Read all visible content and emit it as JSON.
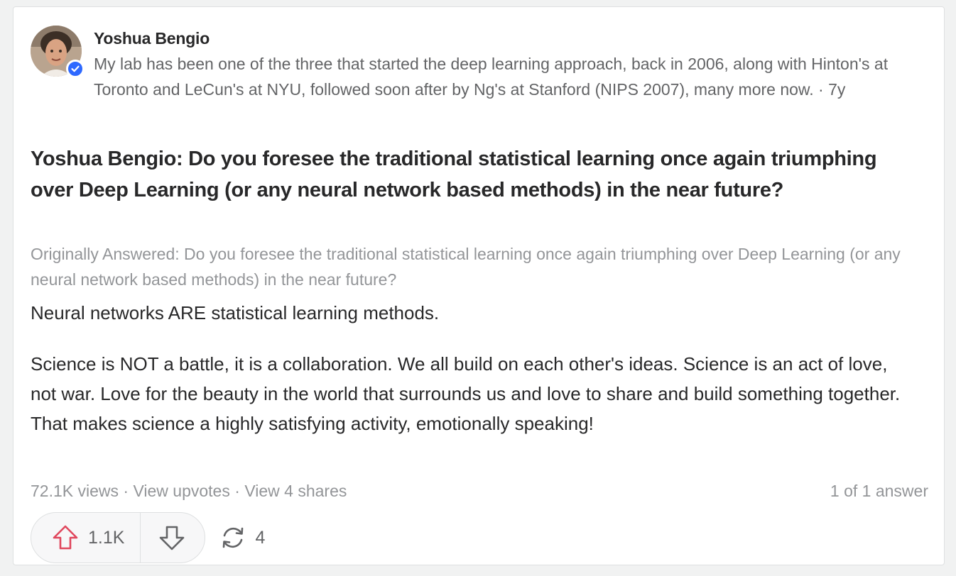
{
  "author": {
    "name": "Yoshua Bengio",
    "credential": "My lab has been one of the three that started the deep learning approach, back in 2006, along with Hinton's at Toronto and LeCun's at NYU, followed soon after by Ng's at Stanford (NIPS 2007), many more now.",
    "separator": "·",
    "time": "7y"
  },
  "question": {
    "title": "Yoshua Bengio: Do you foresee the traditional statistical learning once again triumphing over Deep Learning (or any neural network based methods) in the near future?",
    "originally_answered": "Originally Answered: Do you foresee the traditional statistical learning once again triumphing over Deep Learning (or any neural network based methods) in the near future?"
  },
  "answer": {
    "paragraphs": [
      "Neural networks ARE statistical learning methods.",
      "Science is NOT a battle, it is a collaboration. We all build on each other's ideas. Science is an act of love, not war. Love for the beauty in the world that surrounds us and love to share and build something together. That makes science a highly satisfying activity, emotionally speaking!"
    ]
  },
  "meta": {
    "views": "72.1K views",
    "sep": "·",
    "upvotes_link": "View upvotes",
    "shares_link": "View 4 shares",
    "answer_count": "1 of 1 answer"
  },
  "actions": {
    "upvote_count": "1.1K",
    "share_count": "4",
    "upvote_color": "#e0475d",
    "icons": [
      "arrow-up-icon",
      "arrow-down-icon",
      "share-icon"
    ]
  },
  "colors": {
    "verified": "#2e69ff",
    "text": "#282829",
    "secondary": "#636466",
    "muted": "#939598"
  }
}
